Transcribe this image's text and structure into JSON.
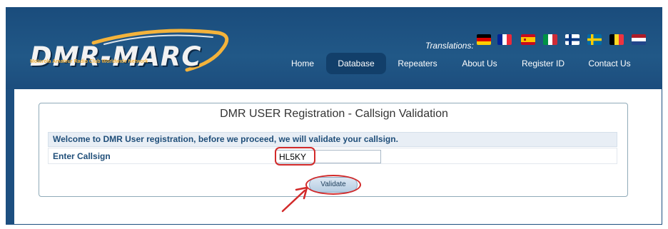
{
  "header": {
    "logo": {
      "text": "DMR-MARC",
      "tagline": "Motorola Amateur Radio Club Worldwide Network"
    },
    "translations_label": "Translations:",
    "flags": [
      {
        "name": "germany-flag-icon",
        "colors": [
          "#000000",
          "#dd0000",
          "#ffce00"
        ]
      },
      {
        "name": "france-flag-icon",
        "colors": [
          "#002395",
          "#ffffff",
          "#ed2939"
        ]
      },
      {
        "name": "spain-flag-icon",
        "colors": [
          "#c60b1e",
          "#ffc400",
          "#c60b1e"
        ]
      },
      {
        "name": "italy-flag-icon",
        "colors": [
          "#009246",
          "#ffffff",
          "#ce2b37"
        ]
      },
      {
        "name": "finland-flag-icon",
        "colors": [
          "#ffffff",
          "#003580"
        ]
      },
      {
        "name": "sweden-flag-icon",
        "colors": [
          "#006aa7",
          "#fecc00"
        ]
      },
      {
        "name": "belgium-flag-icon",
        "colors": [
          "#000000",
          "#fdda24",
          "#ef3340"
        ]
      },
      {
        "name": "netherlands-flag-icon",
        "colors": [
          "#ae1c28",
          "#ffffff",
          "#21468b"
        ]
      }
    ],
    "nav": {
      "items": [
        {
          "label": "Home",
          "active": false
        },
        {
          "label": "Database",
          "active": true
        },
        {
          "label": "Repeaters",
          "active": false
        },
        {
          "label": "About Us",
          "active": false
        },
        {
          "label": "Register ID",
          "active": false
        },
        {
          "label": "Contact Us",
          "active": false
        }
      ]
    }
  },
  "form": {
    "title": "DMR USER Registration - Callsign Validation",
    "welcome": "Welcome to DMR User registration, before we proceed, we will validate your callsign.",
    "callsign_label": "Enter Callsign",
    "callsign_value": "HL5KY",
    "validate_label": "Validate"
  },
  "colors": {
    "header_bg": "#1d4f80",
    "nav_active_bg": "#123f6a",
    "highlight": "#d22a2a",
    "label_text": "#1f4e79"
  }
}
